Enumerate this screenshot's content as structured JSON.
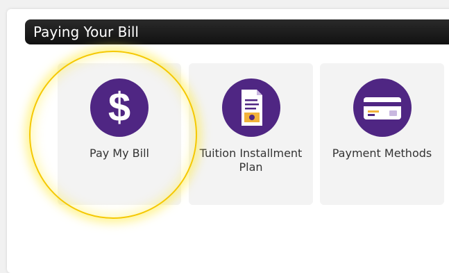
{
  "section": {
    "title": "Paying Your Bill"
  },
  "tiles": [
    {
      "label": "Pay My Bill",
      "icon": "dollar-icon"
    },
    {
      "label": "Tuition Installment Plan",
      "icon": "document-invoice-icon"
    },
    {
      "label": "Payment Methods",
      "icon": "credit-card-icon"
    }
  ],
  "colors": {
    "accent": "#4f2683",
    "highlight": "#f5c800",
    "notice": "#d01010"
  }
}
